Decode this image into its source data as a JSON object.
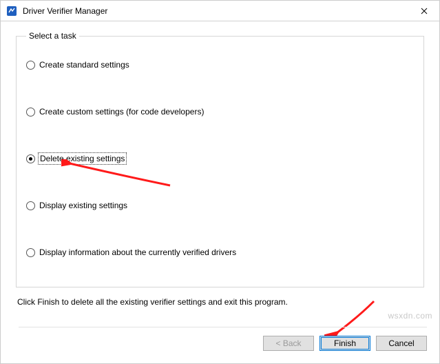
{
  "window": {
    "title": "Driver Verifier Manager"
  },
  "group": {
    "legend": "Select a task"
  },
  "options": {
    "create_standard": "Create standard settings",
    "create_custom": "Create custom settings (for code developers)",
    "delete_existing": "Delete existing settings",
    "display_existing": "Display existing settings",
    "display_info": "Display information about the currently verified drivers"
  },
  "selected_option": "delete_existing",
  "hint": "Click Finish to delete all the existing verifier settings and exit this program.",
  "buttons": {
    "back": "< Back",
    "finish": "Finish",
    "cancel": "Cancel"
  },
  "watermark": "wsxdn.com"
}
